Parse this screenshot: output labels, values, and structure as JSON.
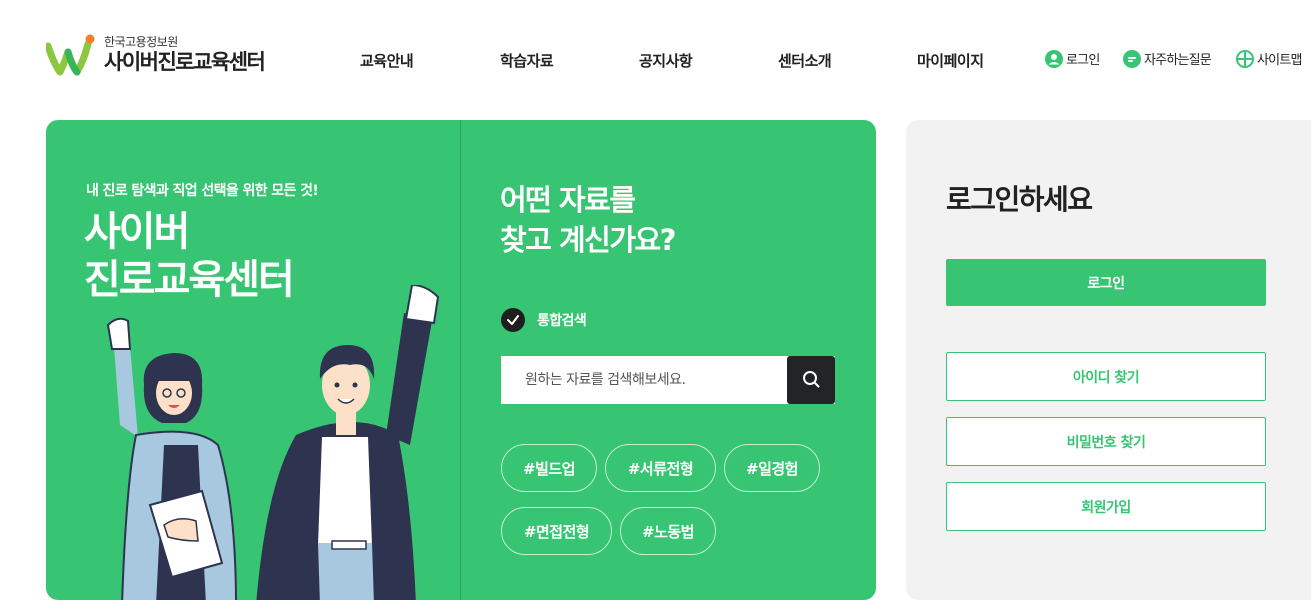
{
  "brand": {
    "org": "한국고용정보원",
    "name": "사이버진로교육센터",
    "colors": {
      "primary": "#38c573",
      "dark": "#222426",
      "logo_orange": "#f27d2c",
      "logo_green": "#8dc63f"
    }
  },
  "gnb": [
    "교육안내",
    "학습자료",
    "공지사항",
    "센터소개",
    "마이페이지"
  ],
  "util": [
    {
      "icon": "user-circle-icon",
      "label": "로그인"
    },
    {
      "icon": "faq-bubble-icon",
      "label": "자주하는질문"
    },
    {
      "icon": "sitemap-icon",
      "label": "사이트맵"
    }
  ],
  "hero": {
    "tagline": "내 진로 탐색과 직업 선택을 위한 모든 것!",
    "title_line1": "사이버",
    "title_line2": "진로교육센터"
  },
  "search": {
    "question_line1": "어떤 자료를",
    "question_line2": "찾고 계신가요?",
    "scope_label": "통합검색",
    "placeholder": "원하는 자료를 검색해보세요.",
    "button_icon": "search-icon"
  },
  "tags": [
    "#빌드업",
    "#서류전형",
    "#일경험",
    "#면접전형",
    "#노동법"
  ],
  "login": {
    "title": "로그인하세요",
    "login_button": "로그인",
    "find_id": "아이디 찾기",
    "find_pw": "비밀번호 찾기",
    "join": "회원가입"
  }
}
